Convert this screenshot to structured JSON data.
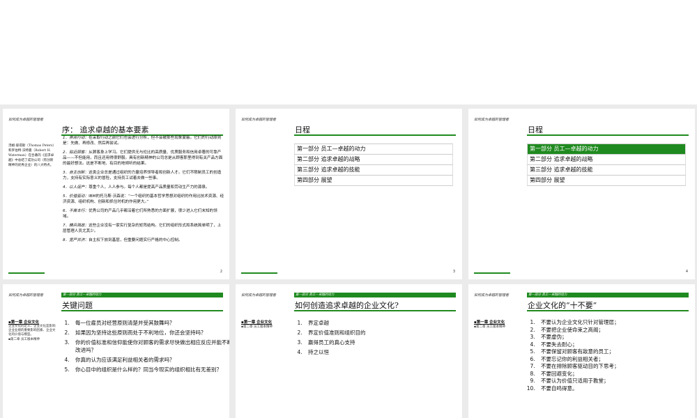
{
  "header": "如何成为卓越的管理者",
  "slides": {
    "s1": {
      "title": "序：  追求卓越的基本要素",
      "sidenote": "汤姆·彼得斯（Thomas Peters）和罗伯特·沃特曼（Robert H. Waterman）在合著的《追求卓越》中总结了成功公司（有创新精神的优秀企业）的八大特点。",
      "items": [
        {
          "k": "1．崇尚行动：",
          "t": "在采取行动之前它们也会进行分析，但不会被那些现象蒙蔽。它们的行动原则是：先做、再修改、然后再尝试。"
        },
        {
          "k": "2．贴近顾客：",
          "t": "从顾客身上学习。它们提供无与伦比的高质量、优质服务和信用卓著的可靠产品——不但能用，而且还用得很舒服。具有创新精神的公司总是从顾客那里得到有关产品方面的最好想法。这是不断地、有目的地倾听的结果。"
        },
        {
          "k": "3．自主创新：",
          "t": "这类企业总是通过组织的力量培养领导者和创新人才。它们不限制员工的创造力，支持有实际意义的冒险，支持员工试着去做一些事。"
        },
        {
          "k": "4．以人促产：",
          "t": "尊重个人，人人参与。每个人都是提高产品质量和劳动生产力的源泉。"
        },
        {
          "k": "5．价值驱动：",
          "t": "IBM的托马斯·沃森说：“一个组织的基本哲学思想对组织的作用比技术资源、经济资源、组织机构、创新和抓住时机的作用更大。”"
        },
        {
          "k": "6．不离本行：",
          "t": "优秀公司的产品几乎都沿着它们所熟悉的方面扩展，很少进入它们未知的领域。"
        },
        {
          "k": "7．精兵简政：",
          "t": "这些企业没有一家实行复杂的矩阵结构。它们的组织形式和系统简单明了，上层管理人员尤其少。"
        },
        {
          "k": "8．宽严并济：",
          "t": "自主权下放到基层，但重要问题实行严格的中心控制。"
        }
      ],
      "page": "2"
    },
    "s2": {
      "title": "日程",
      "agenda": [
        "第一部分 员工—卓越的动力",
        "第二部分 追求卓越的战略",
        "第三部分 追求卓越的技能",
        "第四部分 展望"
      ],
      "page": "3"
    },
    "s3": {
      "title": "日程",
      "agenda": [
        "第一部分 员工—卓越的动力",
        "第二部分 追求卓越的战略",
        "第三部分 追求卓越的技能",
        "第四部分 展望"
      ],
      "page": "4"
    },
    "s4": {
      "section": "第一部分  员工—卓越的动力",
      "title": "关键问题",
      "side_h": "▪第一章 企业文化",
      "side_d": "企业文化的定义、企业文化是影响企业业绩的重要影响因素、企业文化的价值与模型。",
      "side_g": "▪第二章 员工版本精神",
      "items": [
        "每一位雇员对经营原则清楚并受其鼓舞吗？",
        "如果因为坚持这些原则而处于不利地位，你还会坚持吗？",
        "你的价值标准和信仰能使你对顾客的需求尽快做出相应反应并能不断改进吗？",
        "你真的认为应该满足利益相关者的需求吗？",
        "你心目中的组织是什么样的？同当今现实的组织相比有无差别？"
      ]
    },
    "s5": {
      "section": "第一部分  员工—卓越的动力",
      "title": "如何创造追求卓越的企业文化?",
      "side_h": "▪第一章 企业文化",
      "side_g": "▪第二章 员工版本精神",
      "items": [
        "界定卓越",
        "界定价值准则和组织目的",
        "赢得员工的真心支持",
        "持之以恒"
      ]
    },
    "s6": {
      "section": "第一部分  员工—卓越的动力",
      "title": "企业文化的“十不要”",
      "side_h": "▪第一章 企业文化",
      "side_g": "▪第二章 员工版本精神",
      "items": [
        "不要认为企业文化只针对管理层；",
        "不要把企业使命束之高阁；",
        "不要虚伪；",
        "不要失去耐心；",
        "不要保留对顾客有敌意的员工；",
        "不要忘记你的利益相关者；",
        "不要在排除顾客驱动目的下思考；",
        "不要回避变化；",
        "不要认为价值只适用于教堂；",
        "不要自鸣得意。"
      ]
    }
  },
  "colors": {
    "accent": "#1f8a1f"
  }
}
